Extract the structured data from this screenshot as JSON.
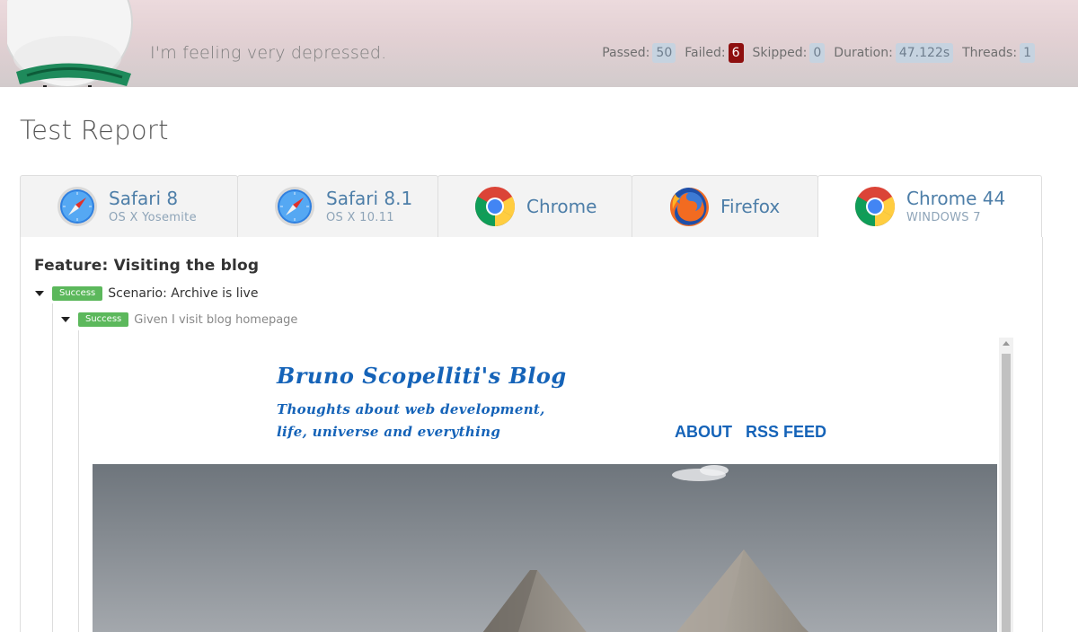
{
  "header": {
    "tagline": "I'm feeling very depressed.",
    "stats": [
      {
        "label": "Passed:",
        "value": "50",
        "status": "neutral"
      },
      {
        "label": "Failed:",
        "value": "6",
        "status": "fail"
      },
      {
        "label": "Skipped:",
        "value": "0",
        "status": "neutral"
      },
      {
        "label": "Duration:",
        "value": "47.122s",
        "status": "neutral"
      },
      {
        "label": "Threads:",
        "value": "1",
        "status": "neutral"
      }
    ]
  },
  "page": {
    "title": "Test Report"
  },
  "tabs": [
    {
      "name": "Safari 8",
      "subtitle": "OS X Yosemite",
      "icon": "safari-icon",
      "active": false
    },
    {
      "name": "Safari 8.1",
      "subtitle": "OS X 10.11",
      "icon": "safari-icon",
      "active": false
    },
    {
      "name": "Chrome",
      "subtitle": "",
      "icon": "chrome-icon",
      "active": false
    },
    {
      "name": "Firefox",
      "subtitle": "",
      "icon": "firefox-icon",
      "active": false
    },
    {
      "name": "Chrome 44",
      "subtitle": "WINDOWS 7",
      "icon": "chrome-icon",
      "active": true
    }
  ],
  "report": {
    "feature": "Feature: Visiting the blog",
    "scenario": {
      "status": "Success",
      "text": "Scenario: Archive is live"
    },
    "step": {
      "status": "Success",
      "text": "Given I visit blog homepage"
    }
  },
  "screenshot": {
    "blog_title": "Bruno Scopelliti's Blog",
    "blog_subtitle": "Thoughts about web development, life, universe and everything",
    "nav": [
      "ABOUT",
      "RSS FEED"
    ]
  },
  "colors": {
    "accent": "#4d7ea8",
    "success": "#5cb85c",
    "fail": "#8e0f0f",
    "blog_blue": "#1563b8"
  }
}
